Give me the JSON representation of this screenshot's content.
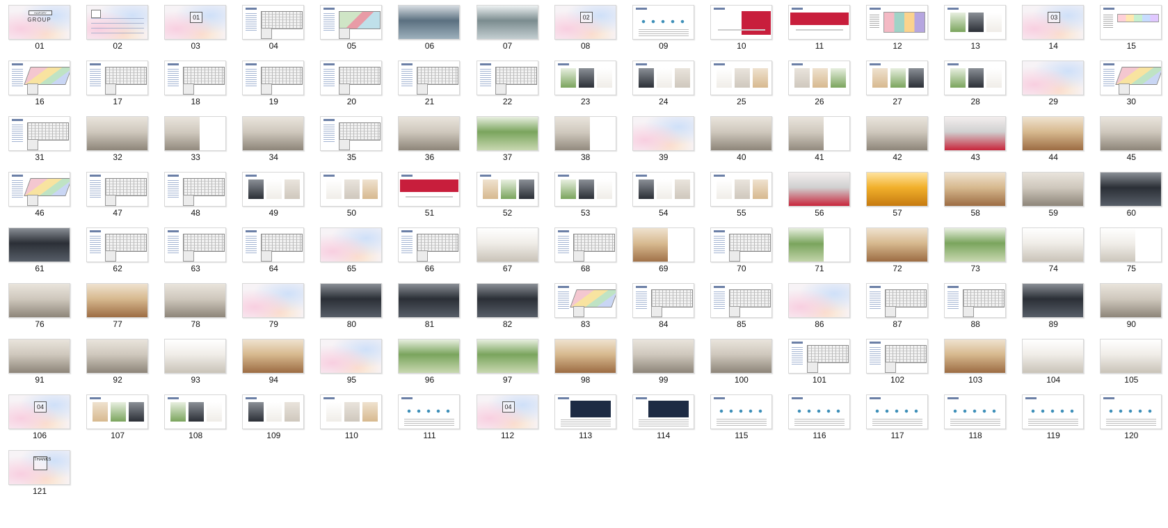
{
  "window": {
    "view": "large-icons",
    "item_count": 121
  },
  "slides": [
    {
      "label": "01",
      "type": "cover",
      "big": "GROUP",
      "box": "HAIFORY"
    },
    {
      "label": "02",
      "type": "toc"
    },
    {
      "label": "03",
      "type": "section",
      "box": "01"
    },
    {
      "label": "04",
      "type": "plan"
    },
    {
      "label": "05",
      "type": "site"
    },
    {
      "label": "06",
      "type": "photo",
      "tone": "aerial"
    },
    {
      "label": "07",
      "type": "photo",
      "tone": "aerial2"
    },
    {
      "label": "08",
      "type": "section",
      "box": "02"
    },
    {
      "label": "09",
      "type": "diagram"
    },
    {
      "label": "10",
      "type": "redpromo"
    },
    {
      "label": "11",
      "type": "red"
    },
    {
      "label": "12",
      "type": "colors"
    },
    {
      "label": "13",
      "type": "photos"
    },
    {
      "label": "14",
      "type": "section",
      "box": "03"
    },
    {
      "label": "15",
      "type": "chart"
    },
    {
      "label": "16",
      "type": "iso"
    },
    {
      "label": "17",
      "type": "plan"
    },
    {
      "label": "18",
      "type": "plan"
    },
    {
      "label": "19",
      "type": "plan"
    },
    {
      "label": "20",
      "type": "plan"
    },
    {
      "label": "21",
      "type": "plan"
    },
    {
      "label": "22",
      "type": "plan"
    },
    {
      "label": "23",
      "type": "photos"
    },
    {
      "label": "24",
      "type": "photos"
    },
    {
      "label": "25",
      "type": "photos"
    },
    {
      "label": "26",
      "type": "photos"
    },
    {
      "label": "27",
      "type": "photos"
    },
    {
      "label": "28",
      "type": "photos"
    },
    {
      "label": "29",
      "type": "pastel"
    },
    {
      "label": "30",
      "type": "iso"
    },
    {
      "label": "31",
      "type": "plan"
    },
    {
      "label": "32",
      "type": "photo",
      "tone": "interior"
    },
    {
      "label": "33",
      "type": "photoHalf",
      "tone": "interior"
    },
    {
      "label": "34",
      "type": "photo",
      "tone": "interior"
    },
    {
      "label": "35",
      "type": "plan"
    },
    {
      "label": "36",
      "type": "photo",
      "tone": "interior"
    },
    {
      "label": "37",
      "type": "photo",
      "tone": "green"
    },
    {
      "label": "38",
      "type": "photoHalf",
      "tone": "interior"
    },
    {
      "label": "39",
      "type": "pastel"
    },
    {
      "label": "40",
      "type": "photo",
      "tone": "interior"
    },
    {
      "label": "41",
      "type": "photoHalf",
      "tone": "interior"
    },
    {
      "label": "42",
      "type": "photo",
      "tone": "interior"
    },
    {
      "label": "43",
      "type": "photo",
      "tone": "red"
    },
    {
      "label": "44",
      "type": "photo",
      "tone": "warm"
    },
    {
      "label": "45",
      "type": "photo",
      "tone": "interior"
    },
    {
      "label": "46",
      "type": "iso"
    },
    {
      "label": "47",
      "type": "plan"
    },
    {
      "label": "48",
      "type": "plan"
    },
    {
      "label": "49",
      "type": "photos"
    },
    {
      "label": "50",
      "type": "photos"
    },
    {
      "label": "51",
      "type": "red"
    },
    {
      "label": "52",
      "type": "photos"
    },
    {
      "label": "53",
      "type": "photos"
    },
    {
      "label": "54",
      "type": "photos"
    },
    {
      "label": "55",
      "type": "photos"
    },
    {
      "label": "56",
      "type": "photo",
      "tone": "red"
    },
    {
      "label": "57",
      "type": "photo",
      "tone": "yellow"
    },
    {
      "label": "58",
      "type": "photo",
      "tone": "warm"
    },
    {
      "label": "59",
      "type": "photo",
      "tone": "interior"
    },
    {
      "label": "60",
      "type": "photo",
      "tone": "dark"
    },
    {
      "label": "61",
      "type": "photo",
      "tone": "dark"
    },
    {
      "label": "62",
      "type": "plan"
    },
    {
      "label": "63",
      "type": "plan"
    },
    {
      "label": "64",
      "type": "plan"
    },
    {
      "label": "65",
      "type": "pastel"
    },
    {
      "label": "66",
      "type": "plan"
    },
    {
      "label": "67",
      "type": "photo",
      "tone": "light"
    },
    {
      "label": "68",
      "type": "plan"
    },
    {
      "label": "69",
      "type": "photoHalf",
      "tone": "warm"
    },
    {
      "label": "70",
      "type": "plan"
    },
    {
      "label": "71",
      "type": "photoHalf",
      "tone": "green"
    },
    {
      "label": "72",
      "type": "photo",
      "tone": "warm"
    },
    {
      "label": "73",
      "type": "photo",
      "tone": "green"
    },
    {
      "label": "74",
      "type": "photo",
      "tone": "light"
    },
    {
      "label": "75",
      "type": "photoHalf",
      "tone": "light"
    },
    {
      "label": "76",
      "type": "photo",
      "tone": "interior"
    },
    {
      "label": "77",
      "type": "photo",
      "tone": "warm"
    },
    {
      "label": "78",
      "type": "photo",
      "tone": "interior"
    },
    {
      "label": "79",
      "type": "pastel"
    },
    {
      "label": "80",
      "type": "photo",
      "tone": "dark"
    },
    {
      "label": "81",
      "type": "photo",
      "tone": "dark"
    },
    {
      "label": "82",
      "type": "photo",
      "tone": "dark"
    },
    {
      "label": "83",
      "type": "iso"
    },
    {
      "label": "84",
      "type": "plan"
    },
    {
      "label": "85",
      "type": "plan"
    },
    {
      "label": "86",
      "type": "pastel"
    },
    {
      "label": "87",
      "type": "plan"
    },
    {
      "label": "88",
      "type": "plan"
    },
    {
      "label": "89",
      "type": "photo",
      "tone": "dark"
    },
    {
      "label": "90",
      "type": "photo",
      "tone": "interior"
    },
    {
      "label": "91",
      "type": "photo",
      "tone": "interior"
    },
    {
      "label": "92",
      "type": "photo",
      "tone": "interior"
    },
    {
      "label": "93",
      "type": "photo",
      "tone": "light"
    },
    {
      "label": "94",
      "type": "photo",
      "tone": "warm"
    },
    {
      "label": "95",
      "type": "pastel"
    },
    {
      "label": "96",
      "type": "photo",
      "tone": "green"
    },
    {
      "label": "97",
      "type": "photo",
      "tone": "green"
    },
    {
      "label": "98",
      "type": "photo",
      "tone": "warm"
    },
    {
      "label": "99",
      "type": "photo",
      "tone": "interior"
    },
    {
      "label": "100",
      "type": "photo",
      "tone": "interior"
    },
    {
      "label": "101",
      "type": "plan"
    },
    {
      "label": "102",
      "type": "plan"
    },
    {
      "label": "103",
      "type": "photo",
      "tone": "warm"
    },
    {
      "label": "104",
      "type": "photo",
      "tone": "light"
    },
    {
      "label": "105",
      "type": "photo",
      "tone": "light"
    },
    {
      "label": "106",
      "type": "section",
      "box": "04"
    },
    {
      "label": "107",
      "type": "photos"
    },
    {
      "label": "108",
      "type": "photos"
    },
    {
      "label": "109",
      "type": "photos"
    },
    {
      "label": "110",
      "type": "photos"
    },
    {
      "label": "111",
      "type": "diagram"
    },
    {
      "label": "112",
      "type": "section",
      "box": "04"
    },
    {
      "label": "113",
      "type": "doc"
    },
    {
      "label": "114",
      "type": "doc"
    },
    {
      "label": "115",
      "type": "diagram"
    },
    {
      "label": "116",
      "type": "diagram"
    },
    {
      "label": "117",
      "type": "diagram"
    },
    {
      "label": "118",
      "type": "diagram"
    },
    {
      "label": "119",
      "type": "diagram"
    },
    {
      "label": "120",
      "type": "diagram"
    },
    {
      "label": "121",
      "type": "thanks",
      "box": "THANKS"
    }
  ],
  "colors": {
    "interior": [
      "#cfc8bd",
      "#8d8579",
      "#e9e4dc"
    ],
    "dark": [
      "#2b2f36",
      "#575e68",
      "#8a8f96"
    ],
    "warm": [
      "#d7b98f",
      "#9c6c43",
      "#efe2cf"
    ],
    "green": [
      "#7aa45d",
      "#c8d8b0",
      "#e8efe0"
    ],
    "red": [
      "#d0d0d0",
      "#c8253b",
      "#f3eeee"
    ],
    "yellow": [
      "#f1b02b",
      "#c67a10",
      "#ffe3a0"
    ],
    "light": [
      "#f0ede8",
      "#c9c3b8",
      "#ffffff"
    ],
    "aerial": [
      "#5b7080",
      "#9db0bc",
      "#d7dde2"
    ],
    "aerial2": [
      "#7b8c8f",
      "#c3ced1",
      "#eef2f3"
    ]
  }
}
